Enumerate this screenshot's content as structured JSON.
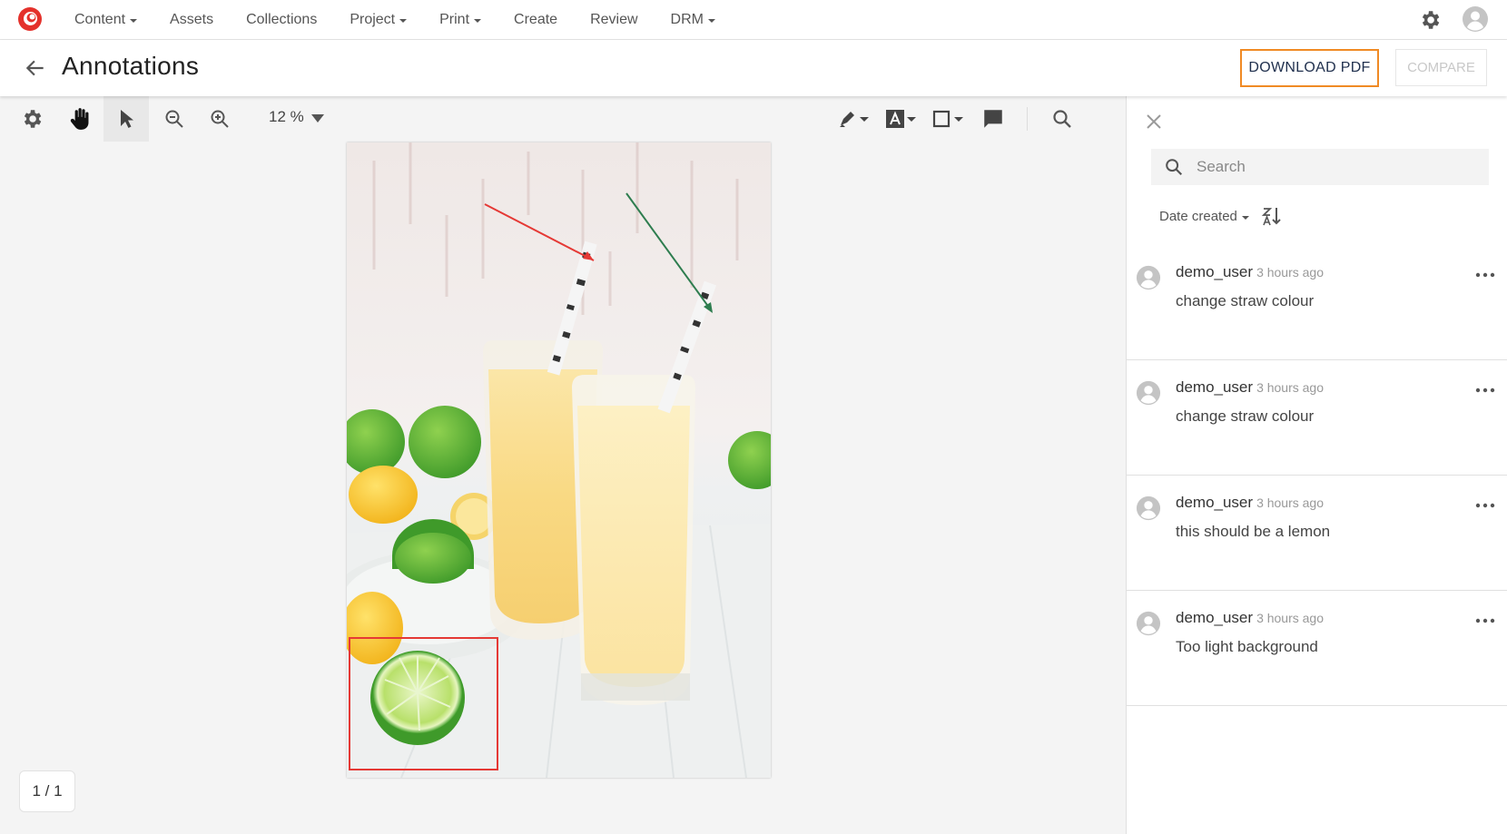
{
  "nav": {
    "items": [
      {
        "label": "Content",
        "dropdown": true
      },
      {
        "label": "Assets",
        "dropdown": false
      },
      {
        "label": "Collections",
        "dropdown": false
      },
      {
        "label": "Project",
        "dropdown": true
      },
      {
        "label": "Print",
        "dropdown": true
      },
      {
        "label": "Create",
        "dropdown": false
      },
      {
        "label": "Review",
        "dropdown": false
      },
      {
        "label": "DRM",
        "dropdown": true
      }
    ],
    "icons": [
      "logo-icon",
      "gear-icon",
      "user-avatar-icon"
    ]
  },
  "header": {
    "title": "Annotations",
    "download_label": "DOWNLOAD PDF",
    "compare_label": "COMPARE",
    "accent_color": "#f08a24"
  },
  "toolbar": {
    "zoom": "12 %",
    "tools": [
      "settings-icon",
      "pan-hand-icon",
      "select-pointer-icon",
      "zoom-out-icon",
      "zoom-in-icon",
      "highlight-pen-icon",
      "free-text-icon",
      "rectangle-icon",
      "comment-icon",
      "search-icon"
    ]
  },
  "viewer": {
    "page_indicator": "1 / 1",
    "annotation_colors": {
      "arrow_red": "#e53935",
      "arrow_green": "#2e7d4f",
      "rectangle": "#e53935"
    }
  },
  "sidebar": {
    "search_placeholder": "Search",
    "sort_label": "Date created",
    "comments": [
      {
        "user": "demo_user",
        "time": "3 hours ago",
        "text": "change straw colour"
      },
      {
        "user": "demo_user",
        "time": "3 hours ago",
        "text": "change straw colour"
      },
      {
        "user": "demo_user",
        "time": "3 hours ago",
        "text": "this should be a lemon"
      },
      {
        "user": "demo_user",
        "time": "3 hours ago",
        "text": "Too light background"
      }
    ]
  }
}
